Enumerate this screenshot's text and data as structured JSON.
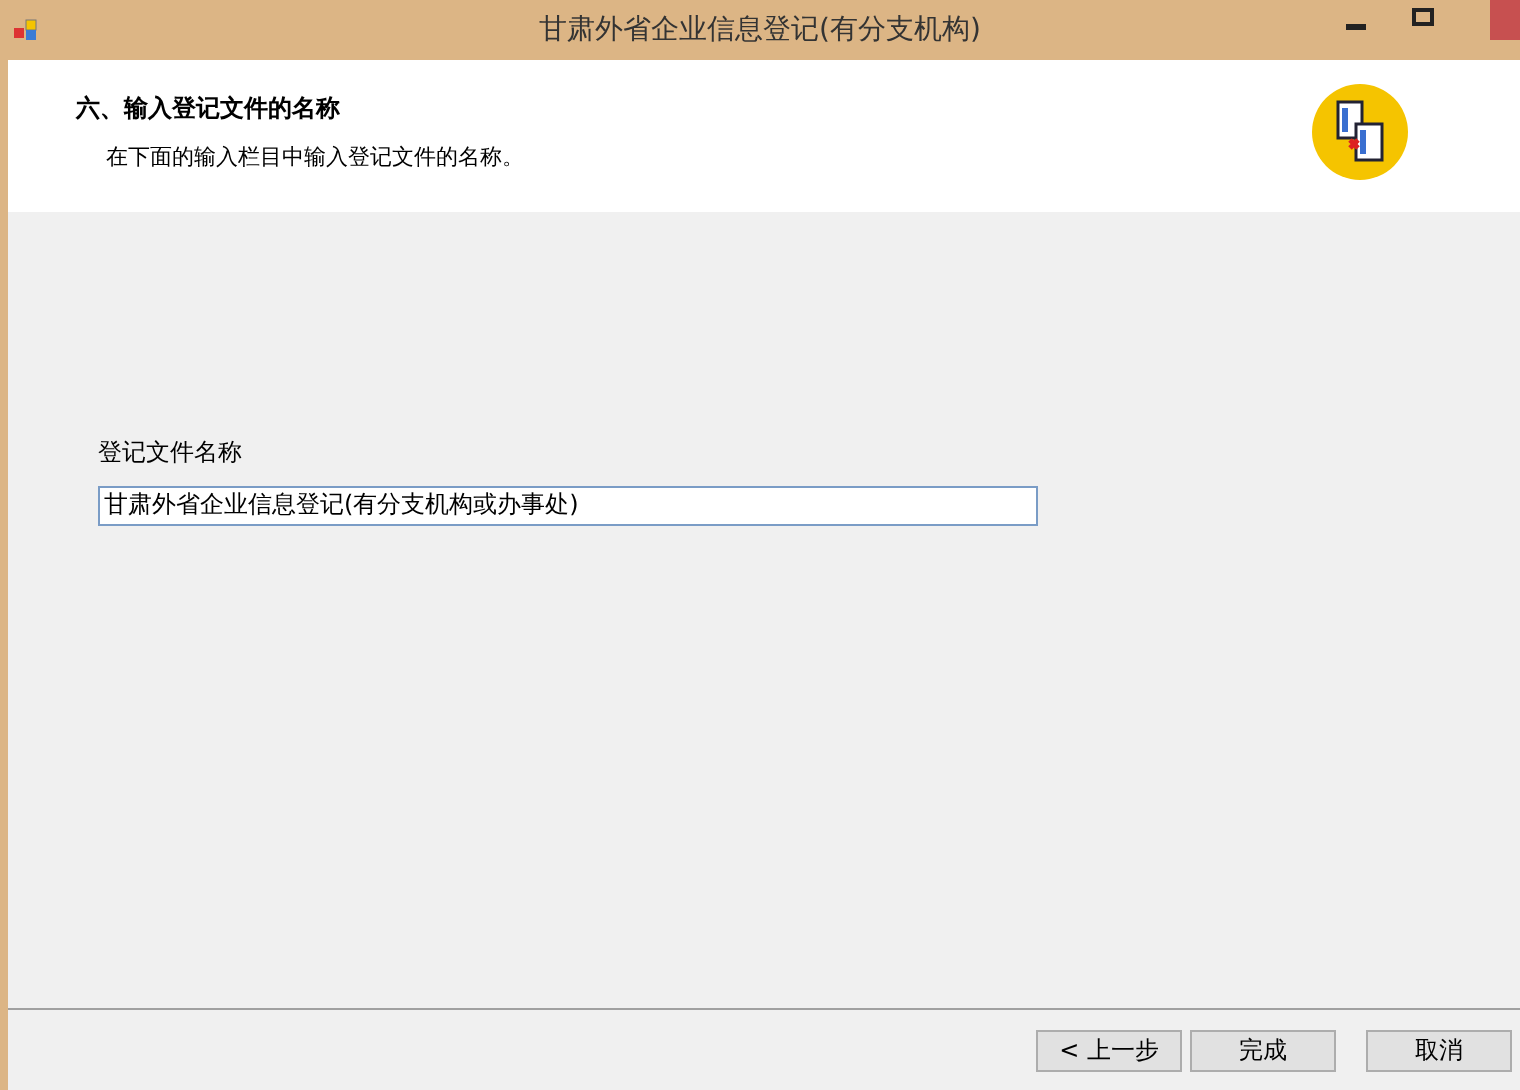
{
  "window": {
    "title": "甘肃外省企业信息登记(有分支机构)"
  },
  "header": {
    "title": "六、输入登记文件的名称",
    "subtitle": "在下面的输入栏目中输入登记文件的名称。"
  },
  "field": {
    "label": "登记文件名称",
    "value": "甘肃外省企业信息登记(有分支机构或办事处)"
  },
  "buttons": [
    {
      "label": "< 上一步"
    },
    {
      "label": "完成"
    },
    {
      "label": "取消"
    }
  ]
}
